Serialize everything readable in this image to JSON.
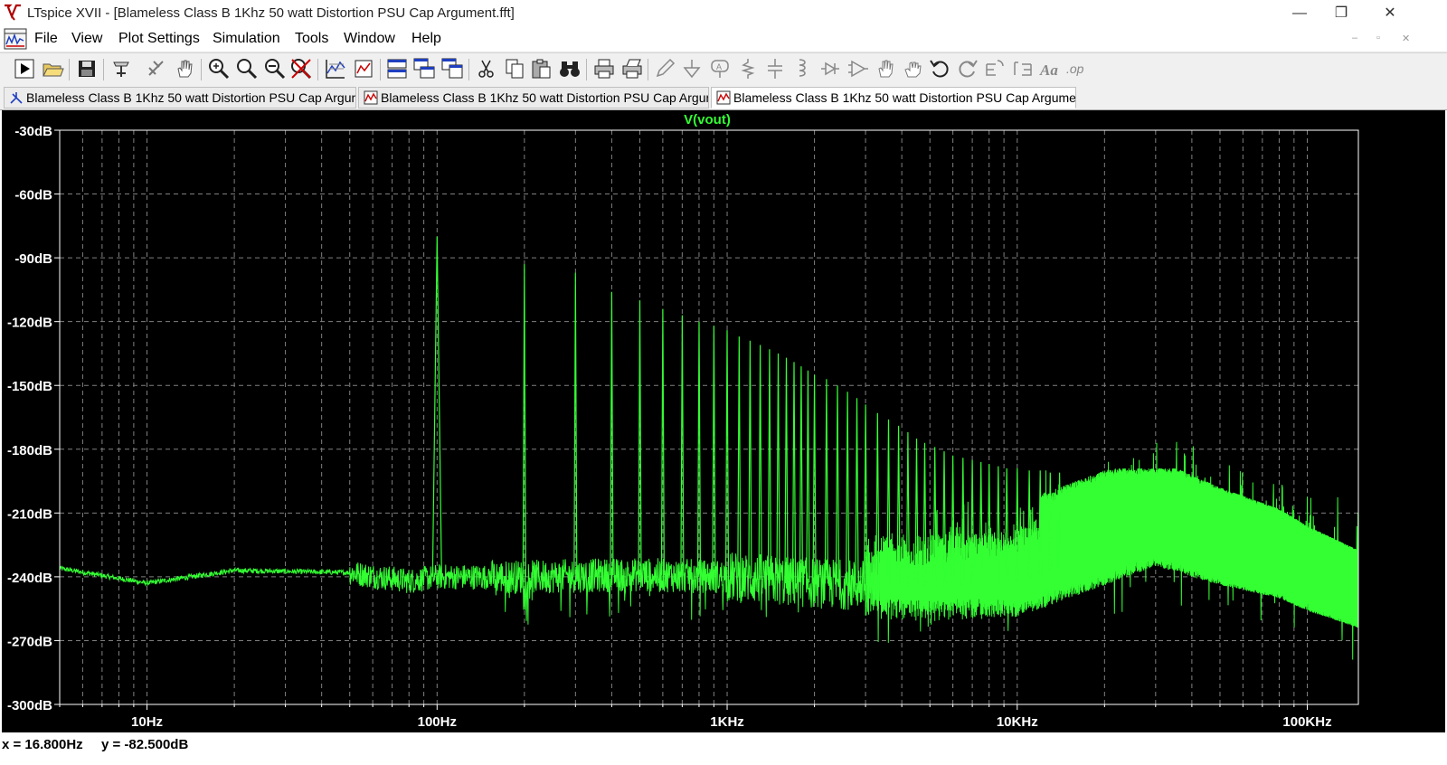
{
  "window": {
    "title": "LTspice XVII - [Blameless Class B 1Khz 50 watt Distortion PSU Cap Argument.fft]",
    "buttons": {
      "minimize": "—",
      "restore": "❐",
      "close": "✕"
    }
  },
  "menu": {
    "items": [
      "File",
      "View",
      "Plot Settings",
      "Simulation",
      "Tools",
      "Window",
      "Help"
    ],
    "mdi": {
      "minimize": "–",
      "restore": "▫",
      "close": "✕"
    }
  },
  "toolbar": {
    "buttons": [
      "run",
      "open",
      "save",
      "control-panel",
      "wire-probe",
      "pan",
      "zoom-area",
      "zoom-in",
      "zoom-out",
      "zoom-cancel",
      "autorange",
      "zoom-fit",
      "tile-horizontal",
      "cascade",
      "tile-vertical",
      "cut",
      "copy",
      "paste",
      "find",
      "print",
      "print-setup",
      "draw",
      "ground",
      "label",
      "resistor",
      "capacitor",
      "inductor",
      "diode",
      "component",
      "move",
      "drag",
      "undo",
      "redo",
      "rotate",
      "mirror",
      "text",
      "spice-directive"
    ]
  },
  "tabs": [
    {
      "label": "Blameless Class B 1Khz 50 watt Distortion PSU Cap Argument",
      "icon": "schematic-icon",
      "active": false
    },
    {
      "label": "Blameless Class B 1Khz 50 watt Distortion PSU Cap Argument",
      "icon": "waveform-icon",
      "active": false
    },
    {
      "label": "Blameless Class B 1Khz 50 watt Distortion PSU Cap Argument.fft",
      "icon": "waveform-icon",
      "active": true
    }
  ],
  "chart_data": {
    "type": "line",
    "title": "V(vout)",
    "xlabel": "",
    "ylabel": "",
    "x_scale": "log",
    "xlim": [
      5,
      150000
    ],
    "ylim": [
      -300,
      -30
    ],
    "grid": true,
    "y_ticks": [
      "-30dB",
      "-60dB",
      "-90dB",
      "-120dB",
      "-150dB",
      "-180dB",
      "-210dB",
      "-240dB",
      "-270dB",
      "-300dB"
    ],
    "y_tick_values": [
      -30,
      -60,
      -90,
      -120,
      -150,
      -180,
      -210,
      -240,
      -270,
      -300
    ],
    "x_ticks": [
      "10Hz",
      "100Hz",
      "1KHz",
      "10KHz",
      "100KHz"
    ],
    "x_tick_values": [
      10,
      100,
      1000,
      10000,
      100000
    ],
    "trace_color": "#33ff33",
    "background": "#000000",
    "grid_color": "#808080",
    "series": [
      {
        "name": "V(vout)",
        "noise_floor": {
          "x": [
            5,
            10,
            20,
            50,
            80,
            100,
            150,
            200,
            500,
            1000,
            2000,
            5000,
            10000,
            20000,
            30000,
            50000,
            80000,
            100000,
            150000
          ],
          "y": [
            -236,
            -243,
            -237,
            -238,
            -242,
            -240,
            -240,
            -240,
            -239,
            -240,
            -243,
            -245,
            -243,
            -228,
            -219,
            -228,
            -234,
            -240,
            -248
          ]
        },
        "harmonics": {
          "x": [
            100,
            200,
            300,
            400,
            500,
            600,
            700,
            800,
            900,
            1000,
            1100,
            1200,
            1300,
            1400,
            1500,
            1600,
            1700,
            1800,
            1900,
            2000,
            2200,
            2400,
            2600,
            2800,
            3000,
            3300,
            3600,
            3900,
            4200,
            4500,
            4800,
            5200,
            5600,
            6000,
            6500,
            7000,
            7500,
            8000,
            8600,
            9200,
            10000,
            11000,
            12000,
            13000,
            14000
          ],
          "y": [
            -80,
            -93,
            -97,
            -106,
            -110,
            -114,
            -117,
            -120,
            -122,
            -124,
            -127,
            -129,
            -131,
            -133,
            -135,
            -137,
            -139,
            -141,
            -143,
            -145,
            -147,
            -150,
            -153,
            -156,
            -159,
            -163,
            -166,
            -169,
            -172,
            -175,
            -177,
            -179,
            -181,
            -183,
            -184,
            -185,
            -186,
            -187,
            -188,
            -189,
            -189,
            -190,
            -190,
            -191,
            -191
          ]
        }
      }
    ]
  },
  "status": {
    "x_readout": "x = 16.800Hz",
    "y_readout": "y = -82.500dB"
  }
}
